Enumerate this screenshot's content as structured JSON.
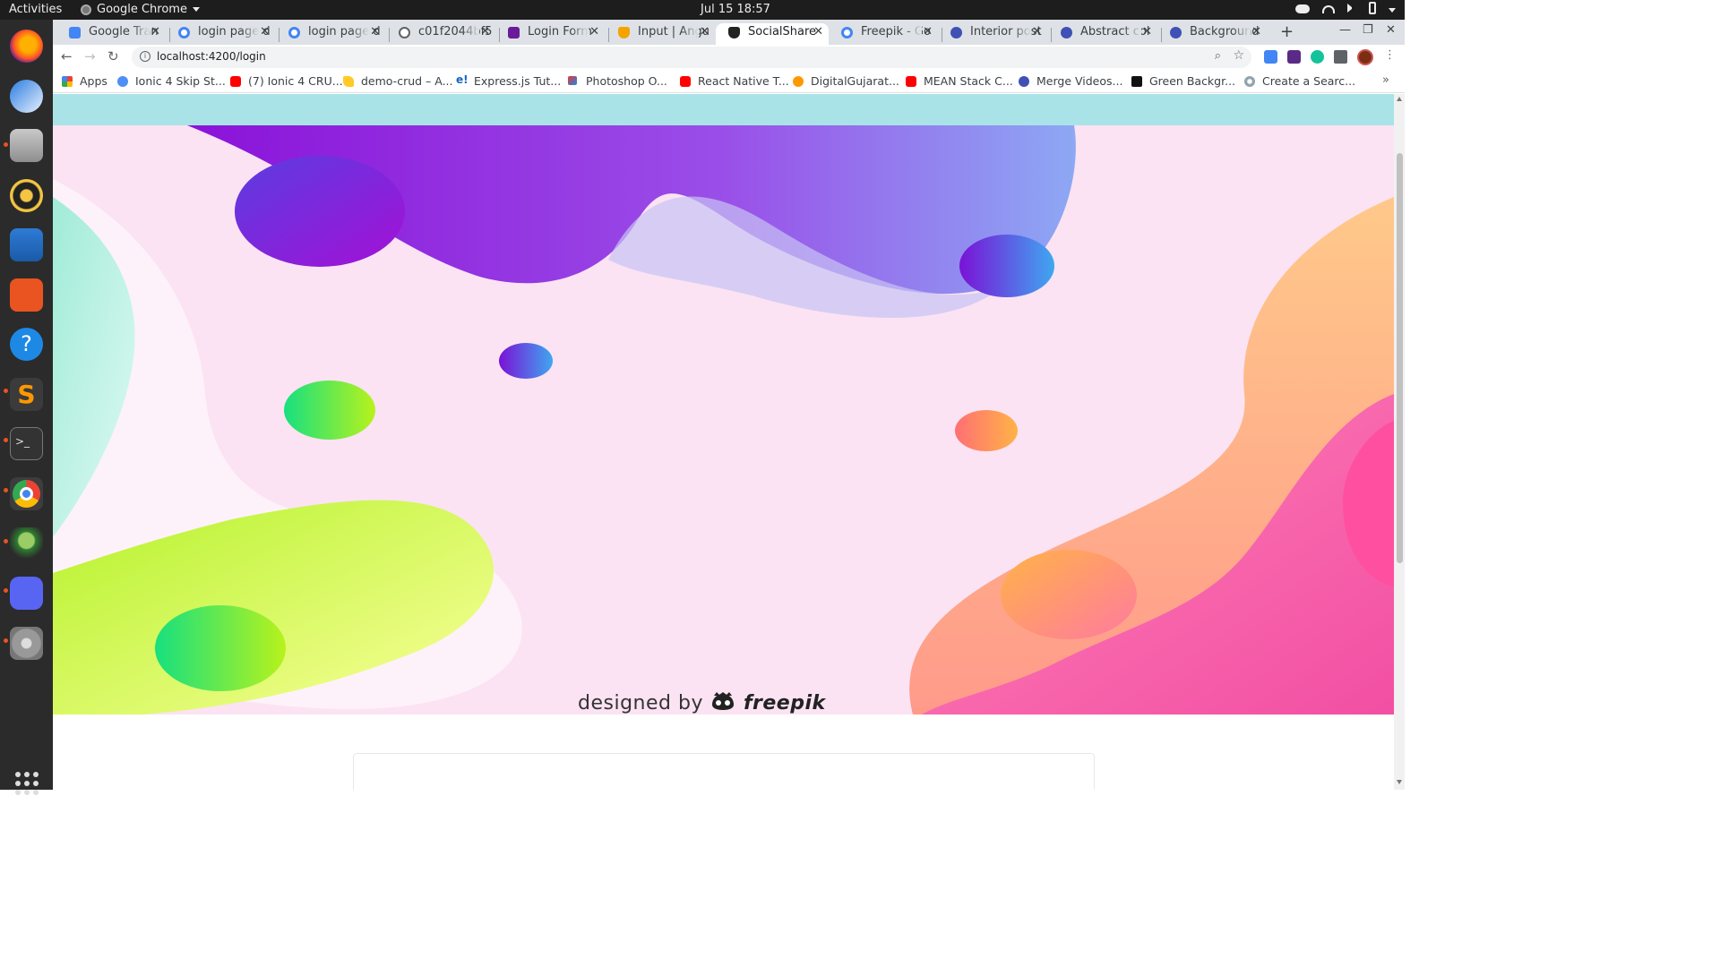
{
  "system": {
    "activities_label": "Activities",
    "app_name": "Google Chrome",
    "clock": "Jul 15  18:57"
  },
  "tabs": [
    {
      "label": "Google Tran",
      "favicon": "google-translate-icon"
    },
    {
      "label": "login page d",
      "favicon": "google-icon"
    },
    {
      "label": "login page d",
      "favicon": "google-icon"
    },
    {
      "label": "c01f2044bf5",
      "favicon": "globe-icon"
    },
    {
      "label": "Login Form",
      "favicon": "codepen-icon"
    },
    {
      "label": "Input | Angu",
      "favicon": "angular-shield-icon"
    },
    {
      "label": "SocialShare",
      "favicon": "angular-icon",
      "active": true
    },
    {
      "label": "Freepik - Go",
      "favicon": "google-icon"
    },
    {
      "label": "Interior post",
      "favicon": "freepik-icon"
    },
    {
      "label": "Abstract col",
      "favicon": "freepik-icon"
    },
    {
      "label": "Background",
      "favicon": "freepik-icon"
    }
  ],
  "address_bar": {
    "url": "localhost:4200/login"
  },
  "bookmarks": [
    {
      "label": "Apps",
      "icon": "apps-grid-icon"
    },
    {
      "label": "Ionic 4 Skip St...",
      "icon": "ionic-icon"
    },
    {
      "label": "(7) Ionic 4 CRU...",
      "icon": "youtube-icon"
    },
    {
      "label": "demo-crud – A...",
      "icon": "firebase-icon"
    },
    {
      "label": "Express.js Tut...",
      "icon": "e-icon"
    },
    {
      "label": "Photoshop O...",
      "icon": "brush-icon"
    },
    {
      "label": "React Native T...",
      "icon": "youtube-icon"
    },
    {
      "label": "DigitalGujarat...",
      "icon": "gujarat-icon"
    },
    {
      "label": "MEAN Stack C...",
      "icon": "youtube-icon"
    },
    {
      "label": "Merge Videos...",
      "icon": "merge-icon"
    },
    {
      "label": "Green Backgr...",
      "icon": "st-icon"
    },
    {
      "label": "Create a Searc...",
      "icon": "search-icon"
    }
  ],
  "page": {
    "hero_credit_prefix": "designed by",
    "hero_credit_brand": "freepik"
  },
  "colors": {
    "navbar": "#a9e3e8",
    "tabstrip": "#dee1e6",
    "dock": "#2b2b2b"
  }
}
